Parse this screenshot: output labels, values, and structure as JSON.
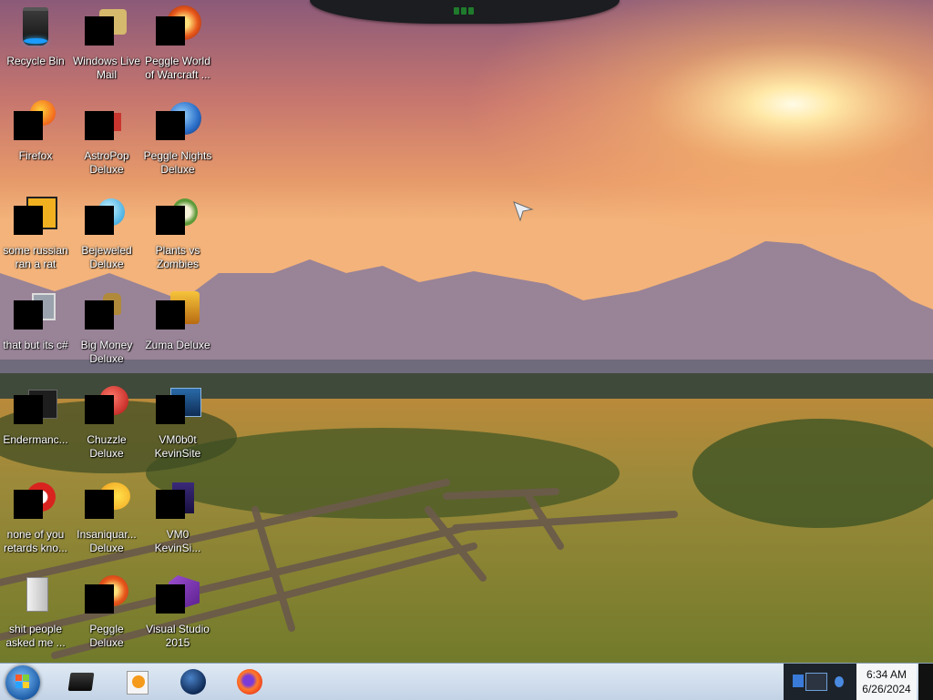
{
  "desktop": {
    "icons": [
      {
        "label": "Recycle Bin"
      },
      {
        "label": "Windows Live\nMail"
      },
      {
        "label": "Peggle World\nof Warcraft ..."
      },
      {
        "label": "Firefox"
      },
      {
        "label": "AstroPop\nDeluxe"
      },
      {
        "label": "Peggle Nights\nDeluxe"
      },
      {
        "label": "some russian\nran a rat"
      },
      {
        "label": "Bejeweled\nDeluxe"
      },
      {
        "label": "Plants vs\nZombies"
      },
      {
        "label": "that but its c#"
      },
      {
        "label": "Big Money\nDeluxe"
      },
      {
        "label": "Zuma Deluxe"
      },
      {
        "label": "Endermanc..."
      },
      {
        "label": "Chuzzle\nDeluxe"
      },
      {
        "label": "VM0b0t\nKevinSite"
      },
      {
        "label": "none of you\nretards kno..."
      },
      {
        "label": "Insaniquar...\nDeluxe"
      },
      {
        "label": "VM0\nKevinSi..."
      },
      {
        "label": "shit people\nasked me ..."
      },
      {
        "label": "Peggle Deluxe"
      },
      {
        "label": "Visual Studio\n2015"
      }
    ]
  },
  "taskbar": {
    "start_icon": "windows-start-orb",
    "pinned": [
      {
        "name": "terminal-icon"
      },
      {
        "name": "media-player-icon"
      },
      {
        "name": "globe-icon"
      },
      {
        "name": "firefox-icon"
      }
    ],
    "clock": {
      "time": "6:34 AM",
      "date": "6/26/2024"
    }
  }
}
